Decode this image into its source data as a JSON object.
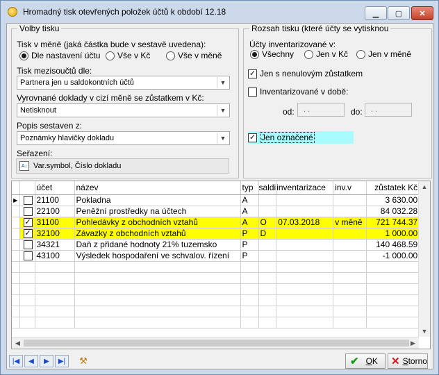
{
  "window": {
    "title": "Hromadný tisk otevřených položek účtů k období 12.18"
  },
  "volby": {
    "legend": "Volby tisku",
    "mena_label": "Tisk v měně (jaká částka bude v sestavě uvedena):",
    "mena_options": [
      "Dle nastavení účtu",
      "Vše v Kč",
      "Vše v měně"
    ],
    "mezisouctu_label": "Tisk mezisoučtů dle:",
    "mezisouctu_value": "Partnera jen u saldokontních účtů",
    "vyrovnane_label": "Vyrovnané doklady v cizí měně se zůstatkem v Kč:",
    "vyrovnane_value": "Netisknout",
    "popis_label": "Popis sestaven z:",
    "popis_value": "Poznámky hlavičky dokladu",
    "serazeni_label": "Seřazení:",
    "serazeni_value": "Var.symbol, Číslo dokladu"
  },
  "rozsah": {
    "legend": "Rozsah tisku (které účty se vytisknou",
    "ucty_label": "Účty inventarizované v:",
    "ucty_options": [
      "Všechny",
      "Jen v Kč",
      "Jen v měně"
    ],
    "nenulovy": "Jen s nenulovým zůstatkem",
    "inventarizovane": "Inventarizované v době:",
    "od_label": "od:",
    "do_label": "do:",
    "od_value": " .  .",
    "do_value": " .  .",
    "oznacene": "Jen označené"
  },
  "grid": {
    "headers": [
      "účet",
      "název",
      "typ",
      "saldi",
      "inventarizace",
      "inv.v",
      "zůstatek Kč"
    ],
    "rows": [
      {
        "checked": false,
        "ucet": "21100",
        "nazev": "Pokladna",
        "typ": "A",
        "saldi": "",
        "inventarizace": "",
        "invv": "",
        "zustatek": "3 630.00"
      },
      {
        "checked": false,
        "ucet": "22100",
        "nazev": "Peněžní prostředky na účtech",
        "typ": "A",
        "saldi": "",
        "inventarizace": "",
        "invv": "",
        "zustatek": "84 032.28"
      },
      {
        "checked": true,
        "ucet": "31100",
        "nazev": "Pohledávky z obchodních vztahů",
        "typ": "A",
        "saldi": "O",
        "inventarizace": "07.03.2018",
        "invv": "v měně",
        "zustatek": "721 744.37"
      },
      {
        "checked": true,
        "ucet": "32100",
        "nazev": "Závazky z obchodních vztahů",
        "typ": "P",
        "saldi": "D",
        "inventarizace": "",
        "invv": "",
        "zustatek": "1 000.00"
      },
      {
        "checked": false,
        "ucet": "34321",
        "nazev": "Daň z přidané hodnoty 21% tuzemsko",
        "typ": "P",
        "saldi": "",
        "inventarizace": "",
        "invv": "",
        "zustatek": "140 468.59"
      },
      {
        "checked": false,
        "ucet": "43100",
        "nazev": "Výsledek hospodaření ve schvalov. řízení",
        "typ": "P",
        "saldi": "",
        "inventarizace": "",
        "invv": "",
        "zustatek": "-1 000.00"
      }
    ]
  },
  "buttons": {
    "ok_label": "OK",
    "ok_underline": "O",
    "ok_rest": "K",
    "storno_label": "Storno",
    "storno_underline": "S",
    "storno_rest": "torno"
  },
  "colors": {
    "highlight": "#ffff00",
    "oznacene_bg": "#a9fbff",
    "ok_check": "#1a9a1a",
    "storno_x": "#d11a1a"
  }
}
